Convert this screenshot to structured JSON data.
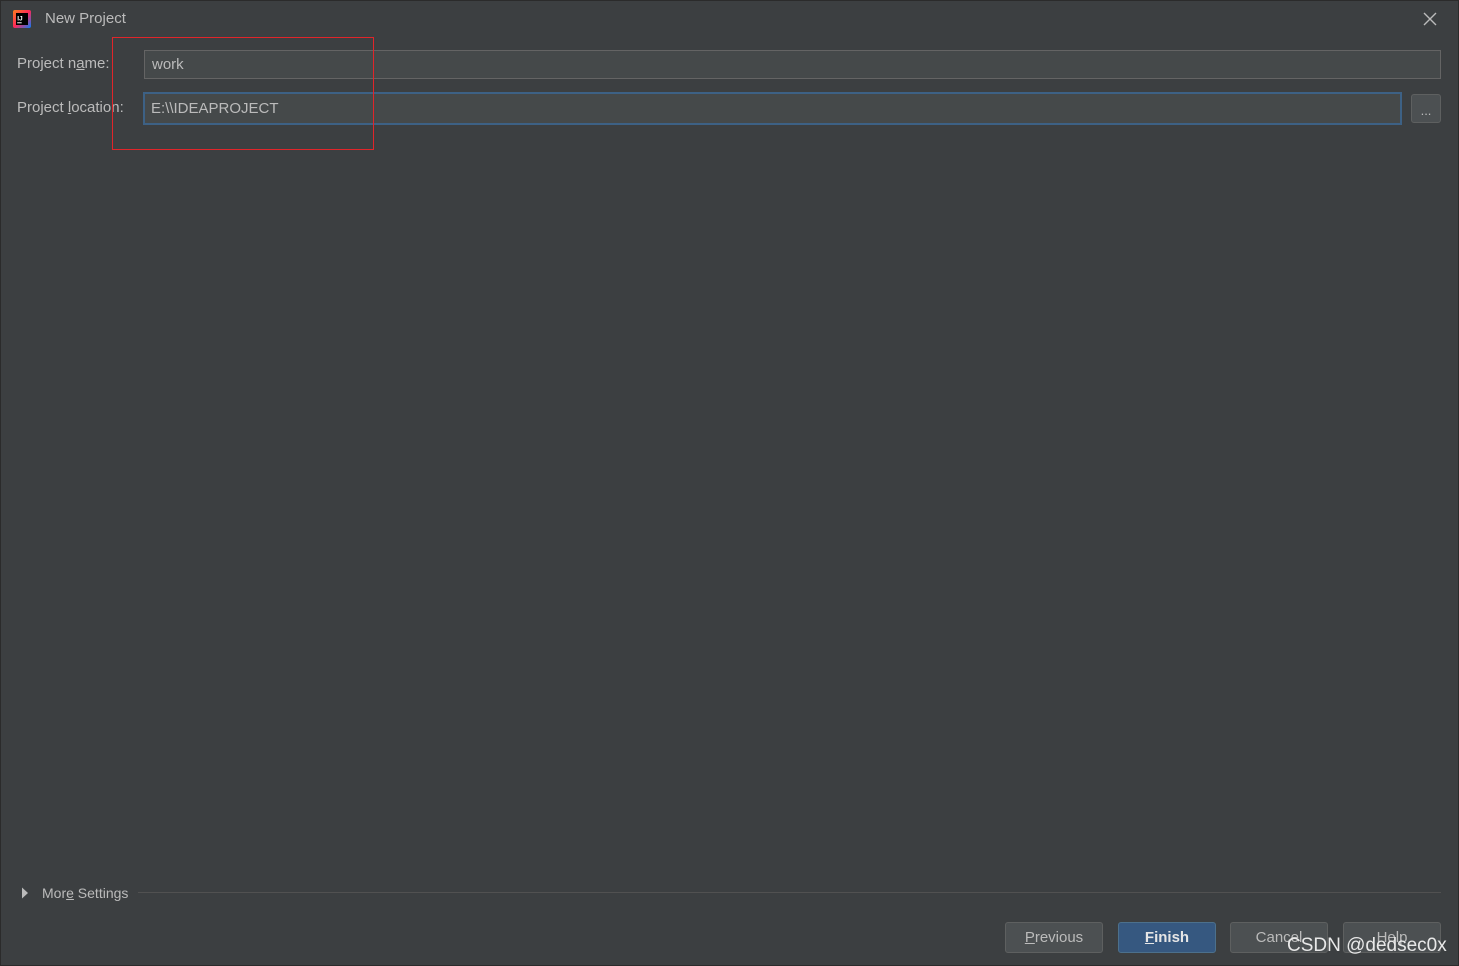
{
  "window": {
    "title": "New Project",
    "app_icon": "intellij-idea-icon",
    "close_icon": "close-icon"
  },
  "form": {
    "project_name": {
      "label_pre": "Project n",
      "label_mnemonic": "a",
      "label_post": "me:",
      "value": "work"
    },
    "project_location": {
      "label_pre": "Project ",
      "label_mnemonic": "l",
      "label_post": "ocation:",
      "value": "E:\\\\IDEAPROJECT",
      "browse_label": "..."
    }
  },
  "more_settings": {
    "label_pre": "Mor",
    "label_mnemonic": "e",
    "label_post": " Settings",
    "icon": "triangle-right-icon",
    "expanded": false
  },
  "buttons": {
    "previous": {
      "mnemonic": "P",
      "rest": "revious"
    },
    "finish": {
      "mnemonic": "F",
      "rest": "inish"
    },
    "cancel": {
      "label": "Cancel"
    },
    "help": {
      "label": "Help"
    }
  },
  "watermark": "CSDN @dedsec0x",
  "colors": {
    "background": "#3c3f41",
    "field_background": "#45494a",
    "focus_border": "#3d6185",
    "primary_button": "#365880",
    "annotation": "#e0252a"
  }
}
